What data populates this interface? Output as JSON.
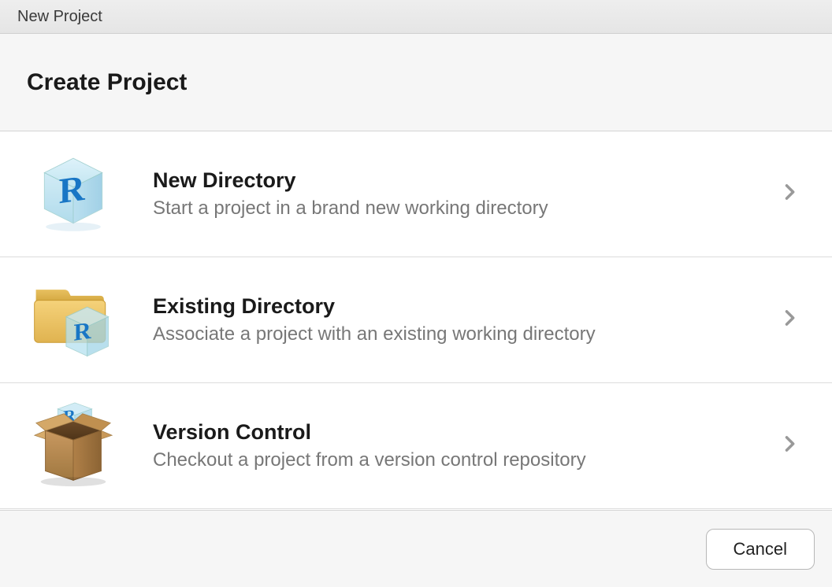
{
  "window": {
    "title": "New Project"
  },
  "header": {
    "title": "Create Project"
  },
  "options": [
    {
      "title": "New Directory",
      "description": "Start a project in a brand new working directory"
    },
    {
      "title": "Existing Directory",
      "description": "Associate a project with an existing working directory"
    },
    {
      "title": "Version Control",
      "description": "Checkout a project from a version control repository"
    }
  ],
  "footer": {
    "cancel_label": "Cancel"
  }
}
